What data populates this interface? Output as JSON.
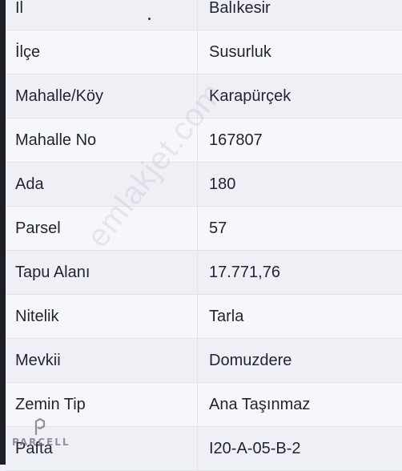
{
  "rows": [
    {
      "label": "İl",
      "value": "Balıkesir"
    },
    {
      "label": "İlçe",
      "value": "Susurluk"
    },
    {
      "label": "Mahalle/Köy",
      "value": "Karapürçek"
    },
    {
      "label": "Mahalle No",
      "value": "167807"
    },
    {
      "label": "Ada",
      "value": "180"
    },
    {
      "label": "Parsel",
      "value": "57"
    },
    {
      "label": "Tapu Alanı",
      "value": "17.771,76"
    },
    {
      "label": "Nitelik",
      "value": "Tarla"
    },
    {
      "label": "Mevkii",
      "value": "Domuzdere"
    },
    {
      "label": "Zemin Tip",
      "value": "Ana Taşınmaz"
    },
    {
      "label": "Pafta",
      "value": "I20-A-05-B-2"
    }
  ],
  "watermark": "emlakjet.com",
  "brand": {
    "text": "PARCELL",
    "icon": "parcell-logo-icon"
  }
}
